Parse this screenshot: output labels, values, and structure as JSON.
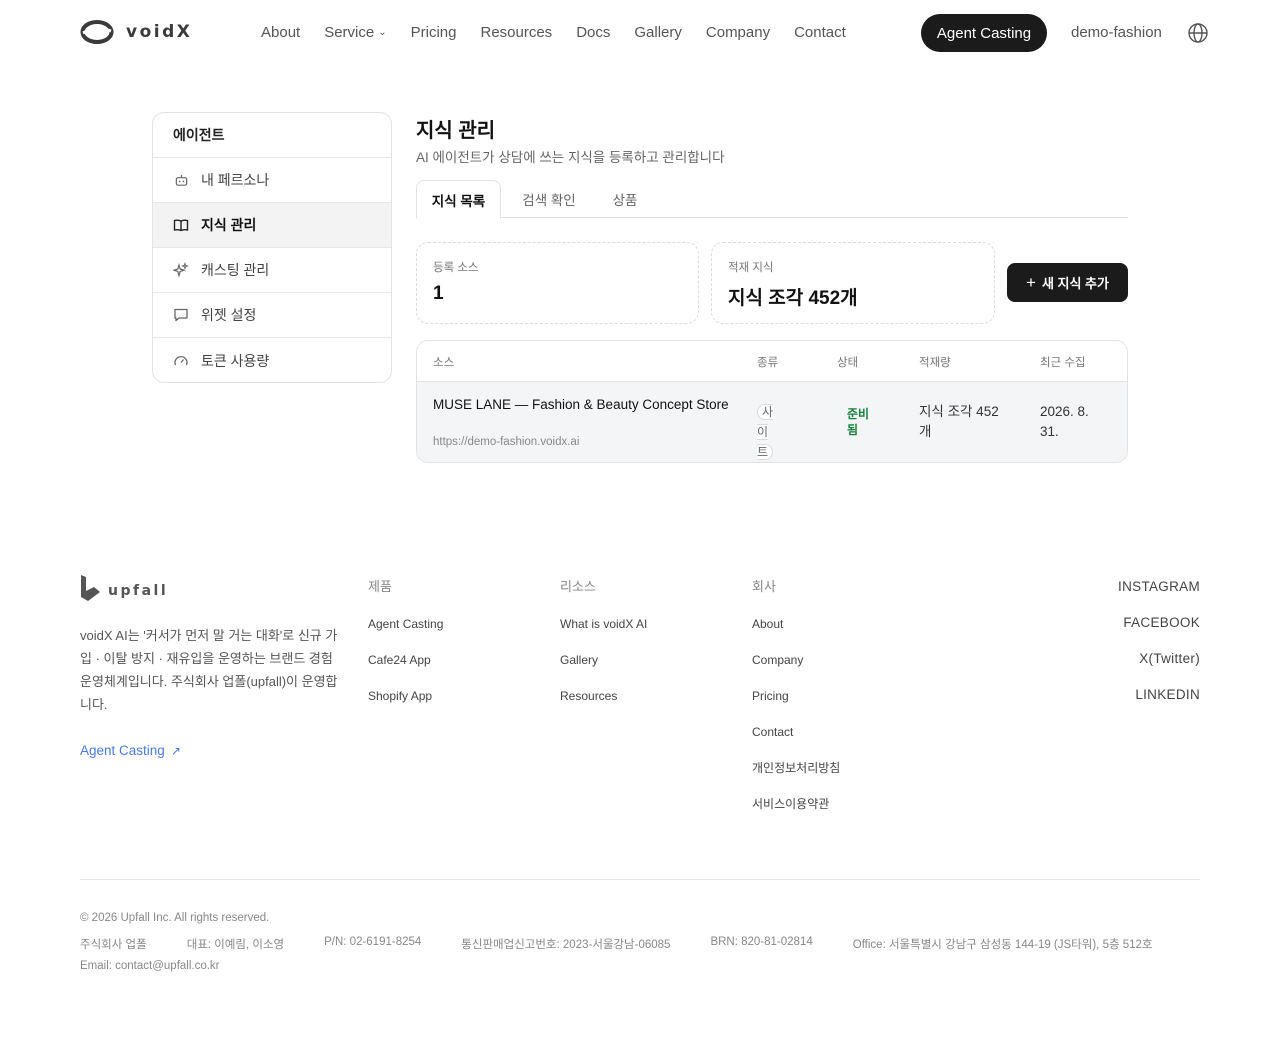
{
  "header": {
    "brand": "voidX",
    "nav": [
      {
        "label": "About"
      },
      {
        "label": "Service",
        "has_dropdown": true
      },
      {
        "label": "Pricing"
      },
      {
        "label": "Resources"
      },
      {
        "label": "Docs"
      },
      {
        "label": "Gallery"
      },
      {
        "label": "Company"
      },
      {
        "label": "Contact"
      }
    ],
    "cta_label": "Agent Casting",
    "account_label": "demo-fashion",
    "language_icon": "globe-icon"
  },
  "sidebar": {
    "title": "에이전트",
    "items": [
      {
        "label": "내 페르소나",
        "icon": "robot-icon",
        "active": false
      },
      {
        "label": "지식 관리",
        "icon": "book-icon",
        "active": true
      },
      {
        "label": "캐스팅 관리",
        "icon": "sparkles-icon",
        "active": false
      },
      {
        "label": "위젯 설정",
        "icon": "chat-bubble-icon",
        "active": false
      },
      {
        "label": "토큰 사용량",
        "icon": "gauge-icon",
        "active": false
      }
    ]
  },
  "main": {
    "title": "지식 관리",
    "subtitle": "AI 에이전트가 상담에 쓰는 지식을 등록하고 관리합니다",
    "tabs": [
      {
        "label": "지식 목록",
        "active": true
      },
      {
        "label": "검색 확인",
        "active": false
      },
      {
        "label": "상품",
        "active": false
      }
    ],
    "stats": [
      {
        "label": "등록 소스",
        "value": "1"
      },
      {
        "label": "적재 지식",
        "value": "지식 조각 452개"
      }
    ],
    "add_button_label": "새 지식 추가",
    "table": {
      "headers": [
        "소스",
        "종류",
        "상태",
        "적재량",
        "최근 수집"
      ],
      "rows": [
        {
          "title": "MUSE LANE — Fashion & Beauty Concept Store",
          "url": "https://demo-fashion.voidx.ai",
          "type": "사이트",
          "status": "준비됨",
          "amount": "지식 조각 452개",
          "date": "2026. 8. 31."
        }
      ]
    }
  },
  "footer": {
    "brand": "upfall",
    "description": "voidX AI는 '커서가 먼저 말 거는 대화'로 신규 가입 · 이탈 방지 · 재유입을 운영하는 브랜드 경험 운영체계입니다. 주식회사 업폴(upfall)이 운영합니다.",
    "cta_label": "Agent Casting",
    "columns": [
      {
        "title": "제품",
        "links": [
          "Agent Casting",
          "Cafe24 App",
          "Shopify App"
        ]
      },
      {
        "title": "리소스",
        "links": [
          "What is voidX AI",
          "Gallery",
          "Resources"
        ]
      },
      {
        "title": "회사",
        "links": [
          "About",
          "Company",
          "Pricing",
          "Contact",
          "개인정보처리방침",
          "서비스이용약관"
        ]
      }
    ],
    "social": [
      "INSTAGRAM",
      "FACEBOOK",
      "X(Twitter)",
      "LINKEDIN"
    ],
    "copyright": "© 2026 Upfall Inc. All rights reserved.",
    "info": [
      "주식회사 업폴",
      "대표: 이예림, 이소영",
      "P/N: 02-6191-8254",
      "통신판매업신고번호: 2023-서울강남-06085",
      "BRN: 820-81-02814",
      "Office: 서울특별시 강남구 삼성동 144-19 (JS타워), 5층 512호"
    ],
    "email": "Email: contact@upfall.co.kr"
  },
  "colors": {
    "primary_dark": "#1b1b1b",
    "accent_link": "#4a7be0",
    "status_ready": "#16803c"
  }
}
